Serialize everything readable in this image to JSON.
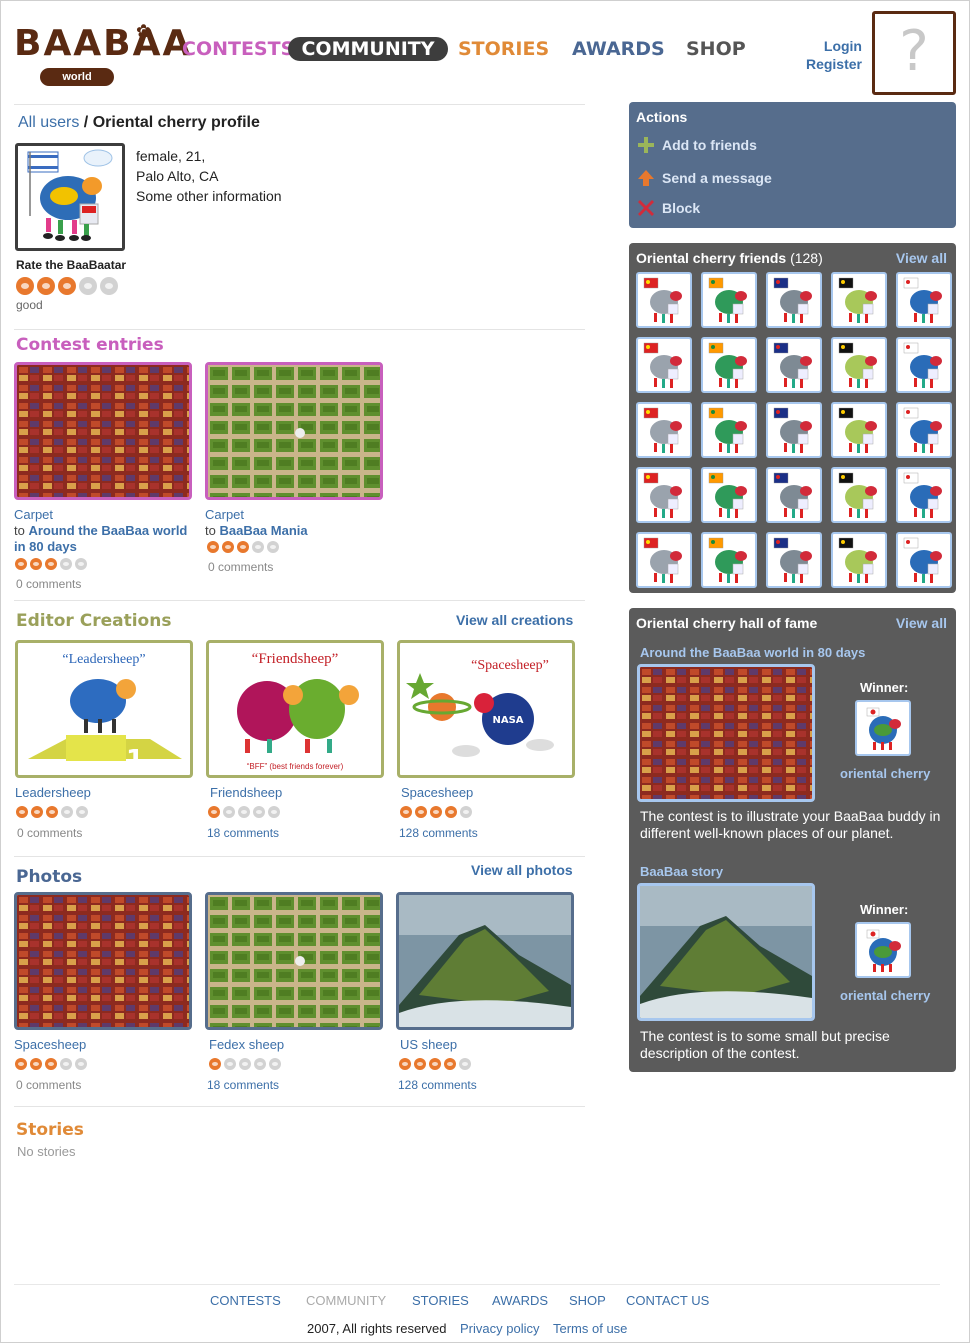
{
  "logo": {
    "word": "BAABAA",
    "sub": "world"
  },
  "nav": {
    "contests": "CONTESTS",
    "community": "COMMUNITY",
    "stories": "STORIES",
    "awards": "AWARDS",
    "shop": "SHOP"
  },
  "auth": {
    "login": "Login",
    "register": "Register",
    "avatar_placeholder": "?"
  },
  "breadcrumb": {
    "all_users": "All users",
    "separator": " / ",
    "current": "Oriental cherry profile"
  },
  "profile": {
    "gender_age": "female, 21,",
    "location": "Palo Alto, CA",
    "other": "Some other information",
    "rate_label": "Rate the BaaBaatar",
    "rating_stars": 3,
    "rating_max": 5,
    "rating_word": "good"
  },
  "contest_entries": {
    "title": "Contest entries",
    "items": [
      {
        "name": "Carpet",
        "to": "to",
        "contest": "Around the BaaBaa world in 80 days",
        "stars": 3,
        "comments": "0 comments"
      },
      {
        "name": "Carpet",
        "to": "to",
        "contest": "BaaBaa Mania",
        "stars": 3,
        "comments": "0 comments"
      }
    ]
  },
  "editor_creations": {
    "title": "Editor Creations",
    "view_all": "View all creations",
    "items": [
      {
        "name": "Leadersheep",
        "art_text": "“Leadersheep”",
        "stars": 3,
        "comments": "0 comments"
      },
      {
        "name": "Friendsheep",
        "art_text": "“Friendsheep”",
        "art_sub": "“BFF” (best friends forever)",
        "stars": 1,
        "comments": "18 comments"
      },
      {
        "name": "Spacesheep",
        "art_text": "“Spacesheep”",
        "art_badge": "NASA",
        "stars": 4,
        "comments": "128 comments"
      }
    ]
  },
  "photos": {
    "title": "Photos",
    "view_all": "View all photos",
    "items": [
      {
        "name": "Spacesheep",
        "stars": 3,
        "comments": "0 comments"
      },
      {
        "name": "Fedex sheep",
        "stars": 1,
        "comments": "18 comments"
      },
      {
        "name": "US sheep",
        "stars": 4,
        "comments": "128 comments"
      }
    ]
  },
  "stories": {
    "title": "Stories",
    "empty": "No stories"
  },
  "actions": {
    "title": "Actions",
    "add_friend": "Add to friends",
    "send_message": "Send a message",
    "block": "Block"
  },
  "friends": {
    "title": "Oriental cherry friends",
    "count": "(128)",
    "view_all": "View all"
  },
  "hall_of_fame": {
    "title": "Oriental cherry hall of fame",
    "view_all": "View all",
    "entries": [
      {
        "contest": "Around the BaaBaa world in 80 days",
        "winner_label": "Winner:",
        "winner": "oriental cherry",
        "desc": "The contest is to illustrate your BaaBaa buddy in different well-known places of our planet."
      },
      {
        "contest": "BaaBaa story",
        "winner_label": "Winner:",
        "winner": "oriental cherry",
        "desc": "The contest is to some small but precise description of the contest."
      }
    ]
  },
  "footer": {
    "contests": "CONTESTS",
    "community": "COMMUNITY",
    "stories": "STORIES",
    "awards": "AWARDS",
    "shop": "SHOP",
    "contact": "CONTACT US",
    "copyright": "2007, All rights reserved",
    "privacy": "Privacy policy",
    "terms": "Terms of use"
  },
  "colors": {
    "brand_brown": "#5a2a12",
    "contests_pink": "#c85fbd",
    "stories_orange": "#e08a37",
    "awards_navy": "#4a6793",
    "link_blue": "#3c6fa8",
    "actions_panel": "#566d8c",
    "dark_panel": "#5b5b5b",
    "star_on": "#e8782d"
  },
  "icons": {
    "add": "plus-icon",
    "message": "arrow-up-icon",
    "block": "x-icon"
  }
}
